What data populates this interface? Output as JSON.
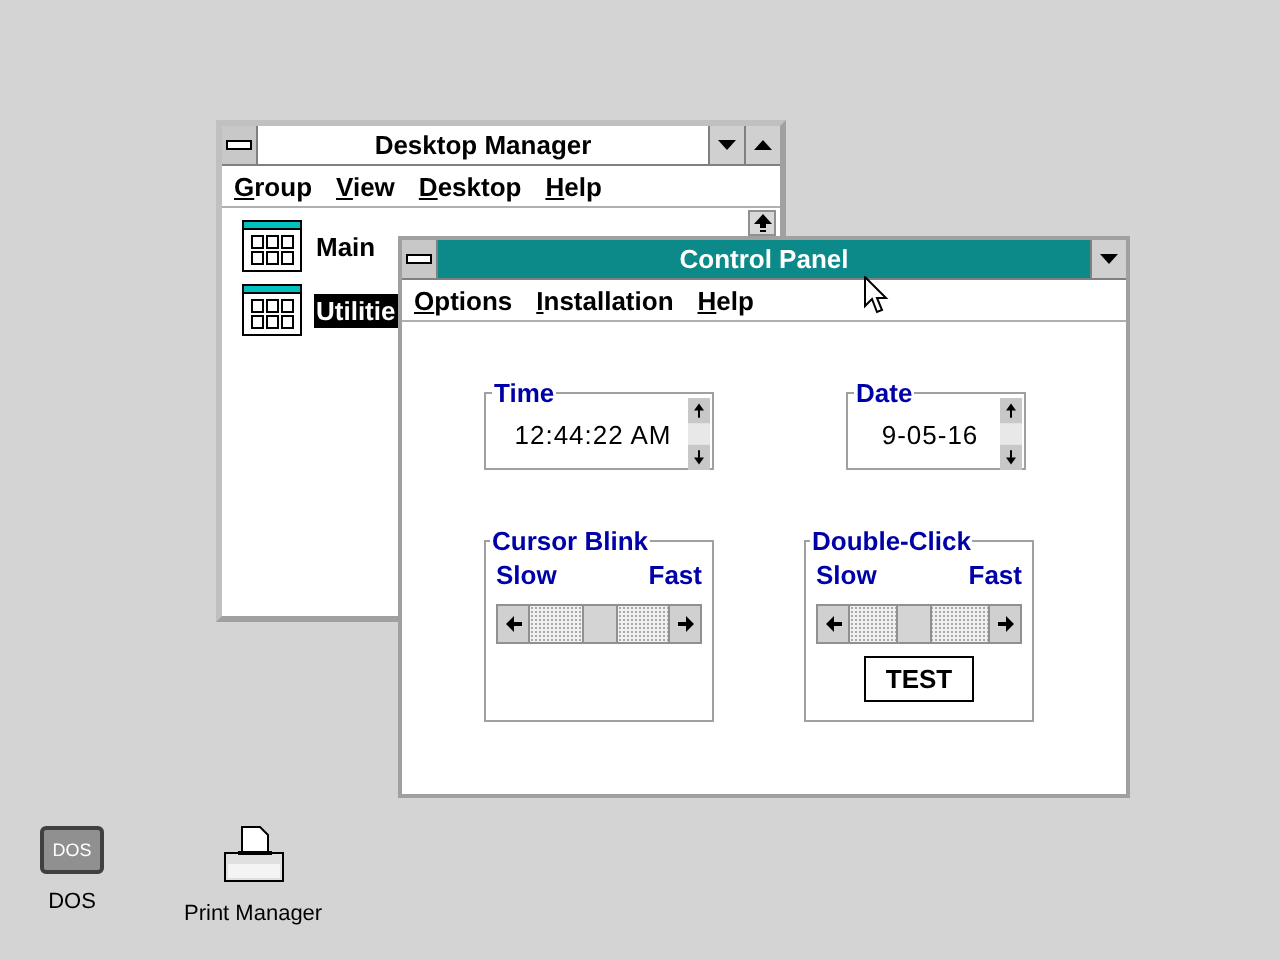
{
  "desktop_manager": {
    "title": "Desktop Manager",
    "active": false,
    "menu": [
      "Group",
      "View",
      "Desktop",
      "Help"
    ],
    "groups": [
      {
        "label": "Main",
        "selected": false
      },
      {
        "label": "Utilitie",
        "selected": true
      }
    ]
  },
  "control_panel": {
    "title": "Control Panel",
    "active": true,
    "menu": [
      "Options",
      "Installation",
      "Help"
    ],
    "time": {
      "label": "Time",
      "value": "12:44:22 AM"
    },
    "date": {
      "label": "Date",
      "value": "9-05-16"
    },
    "sliders": [
      {
        "label": "Cursor Blink",
        "slow": "Slow",
        "fast": "Fast",
        "level": 0.5
      },
      {
        "label": "Double-Click",
        "slow": "Slow",
        "fast": "Fast",
        "level": 0.45,
        "test": "TEST"
      }
    ]
  },
  "desktop_icons": [
    {
      "kind": "dos",
      "badge": "DOS",
      "label": "DOS"
    },
    {
      "kind": "printer",
      "label": "Print Manager"
    }
  ]
}
